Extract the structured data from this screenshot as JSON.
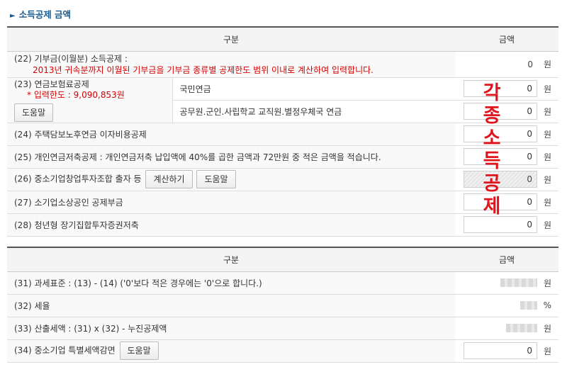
{
  "section1": {
    "title": "소득공제 금액"
  },
  "table1": {
    "header": {
      "col1": "구분",
      "col2": "금액"
    },
    "rows": [
      {
        "label": "(22) 기부금(이월분) 소득공제 :",
        "note": "2013년 귀속분까지 이월된 기부금을 기부금 종류별 공제한도 범위 이내로 계산하여 입력합니다.",
        "value": "0",
        "unit": "원"
      },
      {
        "label": "(23) 연금보험료공제",
        "note": "* 입력한도 : 9,090,853원",
        "button": "도움말",
        "subs": [
          {
            "label": "국민연금",
            "value": "0",
            "unit": "원"
          },
          {
            "label": "공무원.군인.사립학교 교직원.별정우체국 연금",
            "value": "0",
            "unit": "원"
          }
        ]
      },
      {
        "label": "(24) 주택담보노후연금 이자비용공제",
        "value": "0",
        "unit": "원"
      },
      {
        "label": "(25) 개인연금저축공제 : 개인연금저축 납입액에 40%를 곱한 금액과 72만원 중 적은 금액을 적습니다.",
        "value": "0",
        "unit": "원"
      },
      {
        "label": "(26) 중소기업창업투자조합 출자 등",
        "button1": "계산하기",
        "button2": "도움말",
        "value": "0",
        "unit": "원"
      },
      {
        "label": "(27) 소기업소상공인 공제부금",
        "value": "0",
        "unit": "원"
      },
      {
        "label": "(28) 청년형 장기집합투자증권저축",
        "value": "0",
        "unit": "원"
      }
    ]
  },
  "table2": {
    "header": {
      "col1": "구분",
      "col2": "금액"
    },
    "rows": [
      {
        "label": "(31) 과세표준 : (13) - (14) ('0'보다 적은 경우에는 '0'으로 합니다.)",
        "unit": "원"
      },
      {
        "label": "(32) 세율",
        "unit": "%"
      },
      {
        "label": "(33) 산출세액 : (31) x (32) - 누진공제액",
        "unit": "원"
      },
      {
        "label": "(34) 중소기업 특별세액감면",
        "button": "도움말",
        "value": "0",
        "unit": "원"
      }
    ]
  },
  "overlay": {
    "chars": [
      "각",
      "종",
      "소",
      "득",
      "공",
      "제"
    ]
  }
}
